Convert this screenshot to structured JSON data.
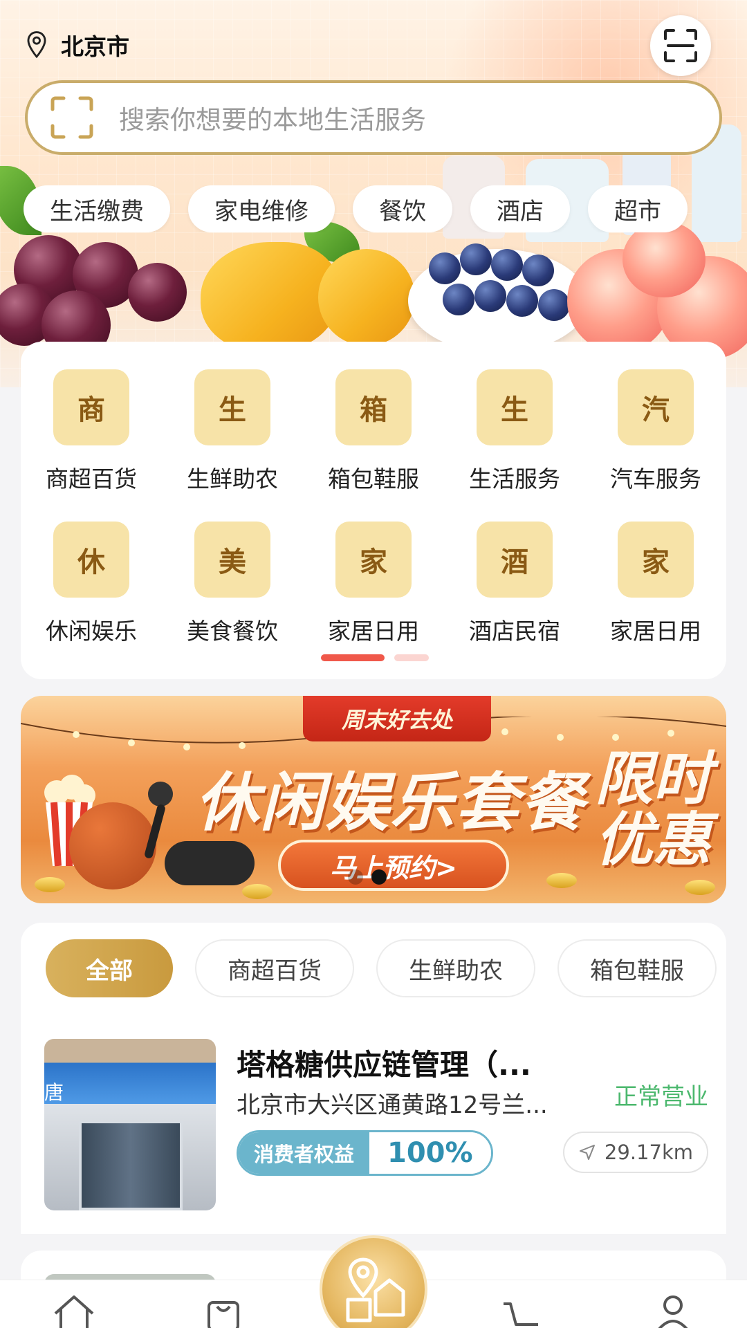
{
  "header": {
    "city": "北京市",
    "search_placeholder": "搜索你想要的本地生活服务"
  },
  "quick_chips": [
    "生活缴费",
    "家电维修",
    "餐饮",
    "酒店",
    "超市"
  ],
  "categories": [
    {
      "icon_char": "商",
      "label": "商超百货"
    },
    {
      "icon_char": "生",
      "label": "生鲜助农"
    },
    {
      "icon_char": "箱",
      "label": "箱包鞋服"
    },
    {
      "icon_char": "生",
      "label": "生活服务"
    },
    {
      "icon_char": "汽",
      "label": "汽车服务"
    },
    {
      "icon_char": "休",
      "label": "休闲娱乐"
    },
    {
      "icon_char": "美",
      "label": "美食餐饮"
    },
    {
      "icon_char": "家",
      "label": "家居日用"
    },
    {
      "icon_char": "酒",
      "label": "酒店民宿"
    },
    {
      "icon_char": "家",
      "label": "家居日用"
    }
  ],
  "category_pager": {
    "pages": 2,
    "current": 1
  },
  "promo": {
    "ribbon": "周末好去处",
    "headline": "休闲娱乐套餐",
    "limited": "限时优惠",
    "cta": "马上预约>",
    "slides": 2,
    "current_slide": 2
  },
  "filter_tabs": [
    {
      "label": "全部",
      "active": true
    },
    {
      "label": "商超百货",
      "active": false
    },
    {
      "label": "生鲜助农",
      "active": false
    },
    {
      "label": "箱包鞋服",
      "active": false
    }
  ],
  "stores": [
    {
      "name": "塔格糖供应链管理（...",
      "address": "北京市大兴区通黄路12号兰...",
      "status": "正常营业",
      "badge_label": "消费者权益",
      "badge_value": "100%",
      "distance": "29.17km",
      "sign_text": "唐"
    }
  ],
  "bottom_nav": [
    "home-icon",
    "bag-icon",
    "location-store-icon",
    "cart-icon",
    "profile-icon"
  ],
  "colors": {
    "accent_gold": "#c99a3e",
    "icon_bg": "#f7e3a8",
    "status_green": "#4cb86e",
    "badge_blue": "#6bb5cc",
    "pager_red": "#f0584a"
  }
}
